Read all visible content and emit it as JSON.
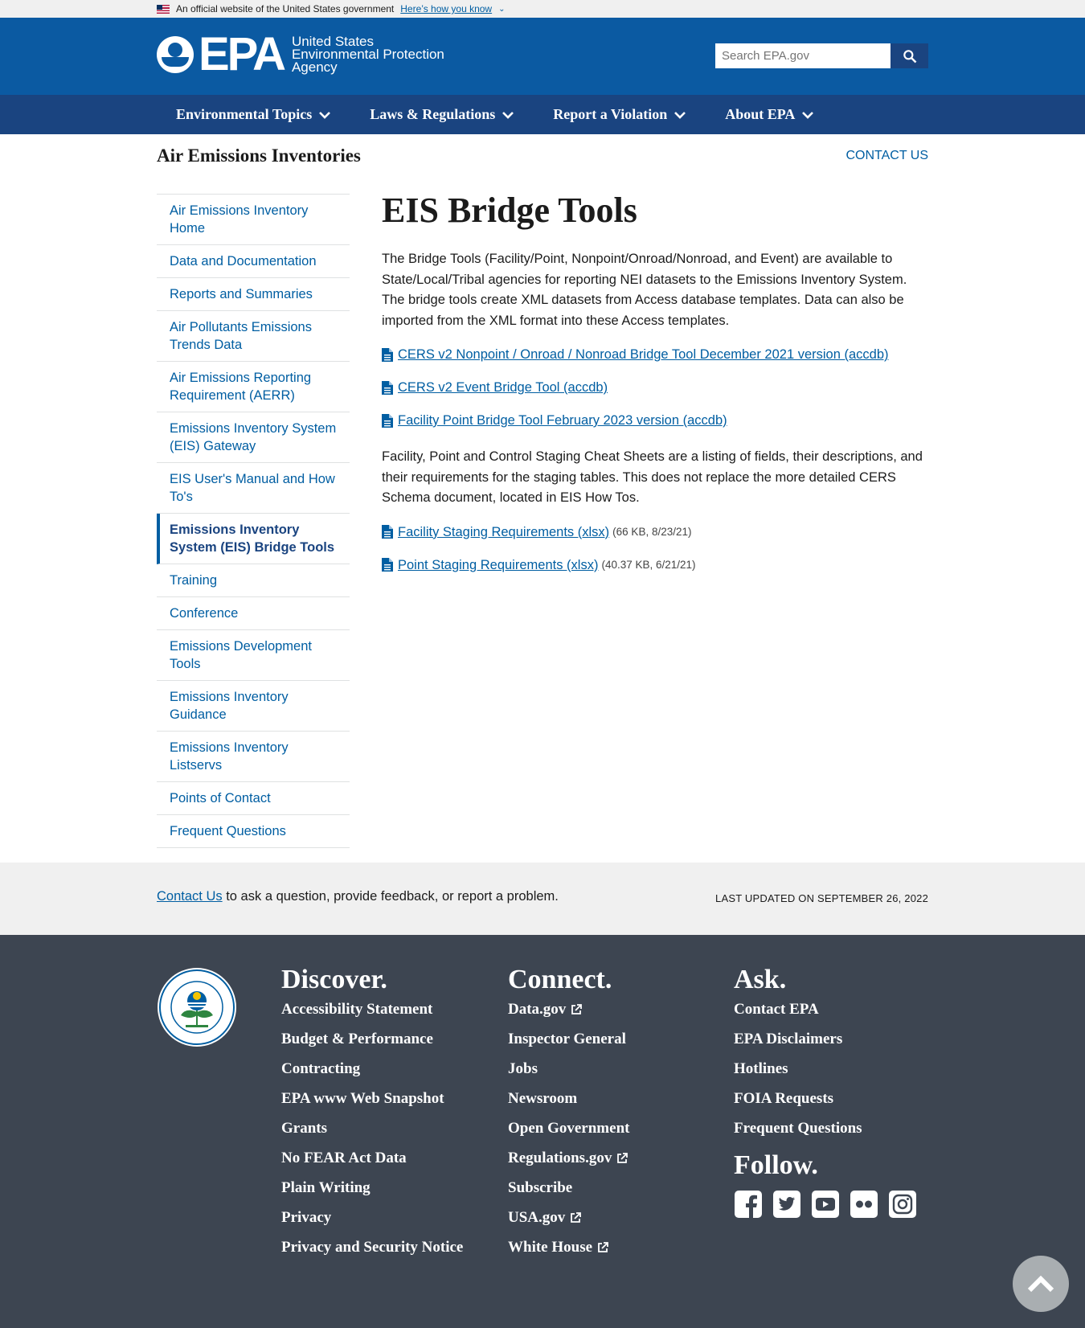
{
  "gov_banner": {
    "text": "An official website of the United States government",
    "link": "Here’s how you know"
  },
  "header": {
    "logo_text": "EPA",
    "agency_line1": "United States",
    "agency_line2": "Environmental Protection",
    "agency_line3": "Agency",
    "search_placeholder": "Search EPA.gov"
  },
  "nav": {
    "items": [
      "Environmental Topics",
      "Laws & Regulations",
      "Report a Violation",
      "About EPA"
    ]
  },
  "subheader": {
    "site_title": "Air Emissions Inventories",
    "contact": "CONTACT US"
  },
  "sidebar": {
    "items": [
      "Air Emissions Inventory Home",
      "Data and Documentation",
      "Reports and Summaries",
      "Air Pollutants Emissions Trends Data",
      "Air Emissions Reporting Requirement (AERR)",
      "Emissions Inventory System (EIS) Gateway",
      "EIS User's Manual and How To's",
      "Emissions Inventory System (EIS) Bridge Tools",
      "Training",
      "Conference",
      "Emissions Development Tools",
      "Emissions Inventory Guidance",
      "Emissions Inventory Listservs",
      "Points of Contact",
      "Frequent Questions"
    ],
    "current_index": 7
  },
  "main": {
    "title": "EIS Bridge Tools",
    "intro": "The Bridge Tools (Facility/Point, Nonpoint/Onroad/Nonroad, and Event) are available to State/Local/Tribal agencies for reporting NEI datasets to the Emissions Inventory System.  The bridge tools create XML datasets from Access database templates.  Data can also be imported from the XML format into these Access templates.",
    "files1": [
      {
        "label": "CERS v2 Nonpoint / Onroad / Nonroad Bridge Tool December 2021 version (accdb)"
      },
      {
        "label": "CERS v2 Event Bridge Tool (accdb)"
      },
      {
        "label": "Facility Point Bridge Tool February 2023 version (accdb)"
      }
    ],
    "staging_text": "Facility, Point and Control Staging Cheat Sheets are a listing of fields, their descriptions, and their requirements for the staging tables. This does not replace the more detailed CERS Schema document, located in EIS How Tos.",
    "files2": [
      {
        "label": "Facility Staging Requirements (xlsx)",
        "meta": "(66 KB, 8/23/21)"
      },
      {
        "label": "Point Staging Requirements (xlsx)",
        "meta": "(40.37 KB, 6/21/21)"
      }
    ]
  },
  "updated": {
    "contact_link": "Contact Us",
    "contact_rest": " to ask a question, provide feedback, or report a problem.",
    "last_updated": "LAST UPDATED ON SEPTEMBER 26, 2022"
  },
  "footer": {
    "discover": {
      "title": "Discover.",
      "links": [
        "Accessibility Statement",
        "Budget & Performance",
        "Contracting",
        "EPA www Web Snapshot",
        "Grants",
        "No FEAR Act Data",
        "Plain Writing",
        "Privacy",
        "Privacy and Security Notice"
      ]
    },
    "connect": {
      "title": "Connect.",
      "links": [
        "Data.gov",
        "Inspector General",
        "Jobs",
        "Newsroom",
        "Open Government",
        "Regulations.gov",
        "Subscribe",
        "USA.gov",
        "White House"
      ]
    },
    "ask": {
      "title": "Ask.",
      "links": [
        "Contact EPA",
        "EPA Disclaimers",
        "Hotlines",
        "FOIA Requests",
        "Frequent Questions"
      ]
    },
    "follow": {
      "title": "Follow.",
      "icons": [
        "facebook-icon",
        "twitter-icon",
        "youtube-icon",
        "flickr-icon",
        "instagram-icon"
      ]
    }
  },
  "colors": {
    "header_blue": "#0b5aa2",
    "nav_blue": "#1a4480",
    "link_blue": "#005ea2",
    "footer_gray": "#3d4551"
  }
}
